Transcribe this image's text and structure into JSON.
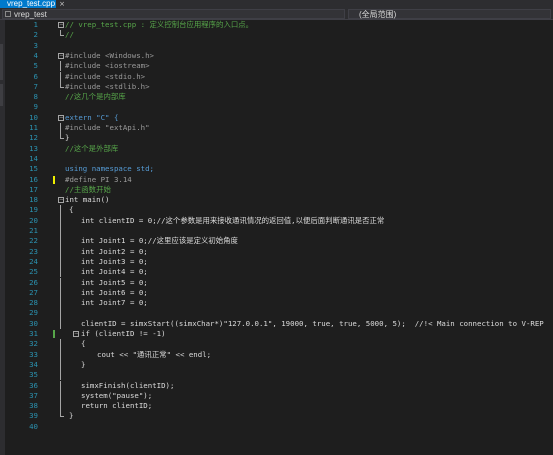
{
  "tab": {
    "title": "vrep_test.cpp",
    "close": "×"
  },
  "navbar": {
    "project": "vrep_test",
    "scope": "(全局范围)"
  },
  "colors": {
    "changed_marker": "#efef00",
    "saved_marker": "#57a64a",
    "line_number": "#2b91af"
  },
  "lines": [
    {
      "n": "1",
      "text": "// vrep_test.cpp : 定义控制台应用程序的入口点。"
    },
    {
      "n": "2",
      "text": "//"
    },
    {
      "n": "3",
      "text": ""
    },
    {
      "n": "4",
      "text": "#include <Windows.h>"
    },
    {
      "n": "5",
      "text": "#include <iostream>"
    },
    {
      "n": "6",
      "text": "#include <stdio.h>"
    },
    {
      "n": "7",
      "text": "#include <stdlib.h>"
    },
    {
      "n": "8",
      "text": "//这几个是内部库"
    },
    {
      "n": "9",
      "text": ""
    },
    {
      "n": "10",
      "text": "extern \"C\" {"
    },
    {
      "n": "11",
      "text": "#include \"extApi.h\""
    },
    {
      "n": "12",
      "text": "}"
    },
    {
      "n": "13",
      "text": "//这个是外部库"
    },
    {
      "n": "14",
      "text": ""
    },
    {
      "n": "15",
      "text": "using namespace std;"
    },
    {
      "n": "16",
      "text": "#define PI 3.14"
    },
    {
      "n": "17",
      "text": "//主函数开始"
    },
    {
      "n": "18",
      "text": "int main()"
    },
    {
      "n": "19",
      "text": "{"
    },
    {
      "n": "20",
      "text": "int clientID = 0;//这个参数是用来接收通讯情况的返回值,以便后面判断通讯是否正常"
    },
    {
      "n": "21",
      "text": ""
    },
    {
      "n": "22",
      "text": "int Joint1 = 0;//这里应该是定义初始角度"
    },
    {
      "n": "23",
      "text": "int Joint2 = 0;"
    },
    {
      "n": "24",
      "text": "int Joint3 = 0;"
    },
    {
      "n": "25",
      "text": "int Joint4 = 0;"
    },
    {
      "n": "26",
      "text": "int Joint5 = 0;"
    },
    {
      "n": "27",
      "text": "int Joint6 = 0;"
    },
    {
      "n": "28",
      "text": "int Joint7 = 0;"
    },
    {
      "n": "29",
      "text": ""
    },
    {
      "n": "30",
      "text": "clientID = simxStart((simxChar*)\"127.0.0.1\", 19000, true, true, 5000, 5);  //!< Main connection to V-REP"
    },
    {
      "n": "31",
      "text": "if (clientID != -1)"
    },
    {
      "n": "32",
      "text": "{"
    },
    {
      "n": "33",
      "text": "cout << \"通讯正常\" << endl;"
    },
    {
      "n": "34",
      "text": "}"
    },
    {
      "n": "35",
      "text": ""
    },
    {
      "n": "36",
      "text": "simxFinish(clientID);"
    },
    {
      "n": "37",
      "text": "system(\"pause\");"
    },
    {
      "n": "38",
      "text": "return clientID;"
    },
    {
      "n": "39",
      "text": "}"
    },
    {
      "n": "40",
      "text": ""
    }
  ]
}
